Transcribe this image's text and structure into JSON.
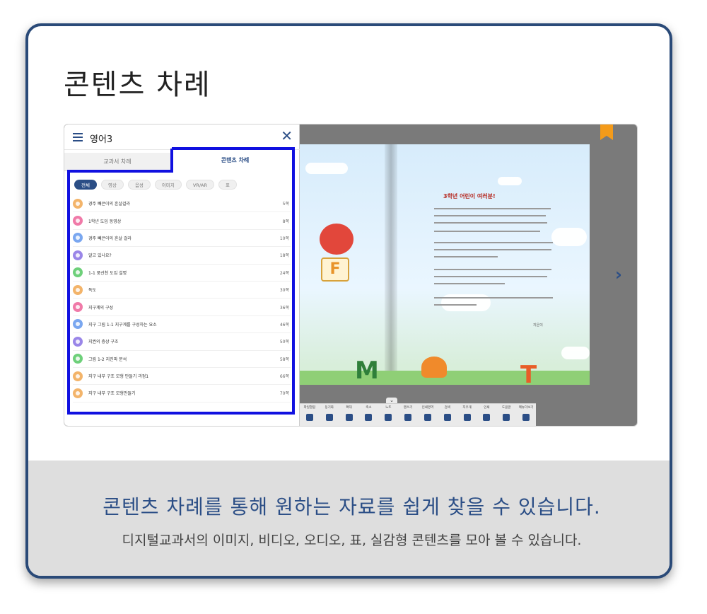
{
  "card": {
    "title": "콘텐츠 차례",
    "footer_main": "콘텐츠 차례를 통해 원하는 자료를 쉽게 찾을 수 있습니다.",
    "footer_sub": "디지털교과서의 이미지, 비디오, 오디오, 표, 실감형 콘텐츠를 모아 볼 수 있습니다."
  },
  "panel": {
    "title": "영어3",
    "close_icon": "close-icon",
    "tabs": [
      "교과서 차례",
      "콘텐츠 차례"
    ],
    "active_tab": "콘텐츠 차례",
    "filters": [
      "전체",
      "영상",
      "음성",
      "이미지",
      "VR/AR",
      "표"
    ],
    "active_filter": "전체",
    "items": [
      {
        "label": "경주 빼은이의 흔살걸라",
        "page": "5쪽",
        "color": "#f3b46a"
      },
      {
        "label": "1학년 도입 동영상",
        "page": "8쪽",
        "color": "#f07aa8"
      },
      {
        "label": "경주 빼은이의 흔살 걸라",
        "page": "10쪽",
        "color": "#7aa7f0"
      },
      {
        "label": "알고 있나요?",
        "page": "18쪽",
        "color": "#9a86e8"
      },
      {
        "label": "1-1 풍선천 도입 설명",
        "page": "24쪽",
        "color": "#6ed07a"
      },
      {
        "label": "독도",
        "page": "30쪽",
        "color": "#f3b46a"
      },
      {
        "label": "지구계의 구성",
        "page": "36쪽",
        "color": "#f07aa8"
      },
      {
        "label": "지구 그림 1-1 지구계를 구성하는 요소",
        "page": "46쪽",
        "color": "#7aa7f0"
      },
      {
        "label": "지권의 층상 구조",
        "page": "50쪽",
        "color": "#9a86e8"
      },
      {
        "label": "그림 1-2 지진파 분석",
        "page": "58쪽",
        "color": "#6ed07a"
      },
      {
        "label": "지구 내부 구조 모형 만들기 과정1",
        "page": "66쪽",
        "color": "#f3b46a"
      },
      {
        "label": "지구 내부 구조 모형만들기",
        "page": "70쪽",
        "color": "#f3b46a"
      }
    ]
  },
  "book": {
    "story_title": "3학년 어린이 여러분!",
    "signature": "지은이",
    "letters": [
      "F",
      "M",
      "T"
    ],
    "next_icon": "chevron-right-icon",
    "bookmark_icon": "bookmark-icon"
  },
  "toolbar": {
    "toggle_icon": "chevron-down-icon",
    "tools": [
      {
        "label": "파일열람",
        "icon": "folder-icon"
      },
      {
        "label": "동기화",
        "icon": "sync-icon"
      },
      {
        "label": "확대",
        "icon": "zoom-in-icon"
      },
      {
        "label": "축소",
        "icon": "zoom-out-icon"
      },
      {
        "label": "노트",
        "icon": "note-icon"
      },
      {
        "label": "펜쓰기",
        "icon": "pen-icon"
      },
      {
        "label": "인쇄영역",
        "icon": "page-icon"
      },
      {
        "label": "검색",
        "icon": "search-icon"
      },
      {
        "label": "지우개",
        "icon": "eraser-icon"
      },
      {
        "label": "인쇄",
        "icon": "print-icon"
      },
      {
        "label": "도움말",
        "icon": "help-icon"
      },
      {
        "label": "메뉴더보기",
        "icon": "grid-icon"
      }
    ]
  }
}
